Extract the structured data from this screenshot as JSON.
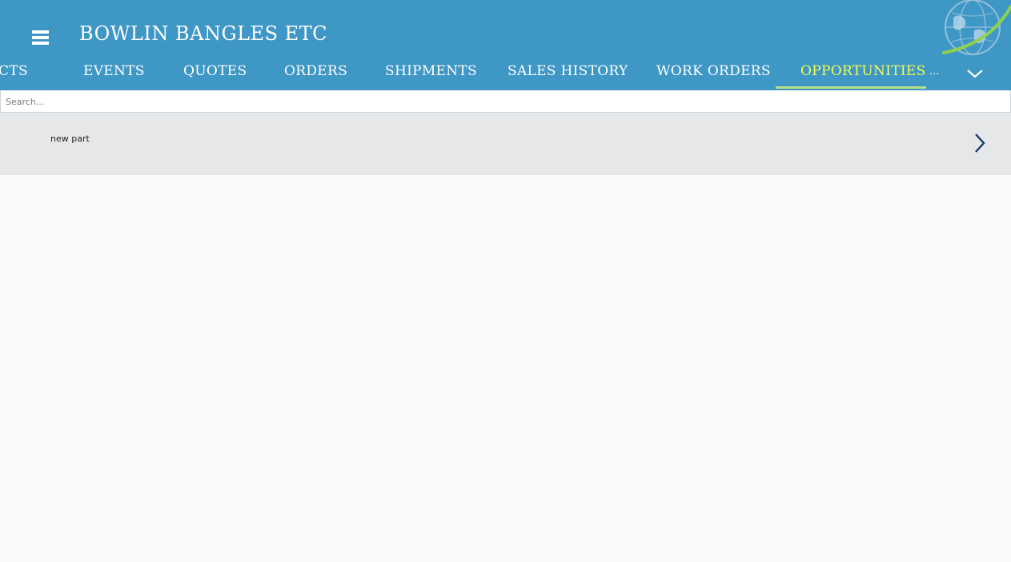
{
  "app": {
    "title": "BOWLIN BANGLES ETC"
  },
  "nav": {
    "tabs": [
      {
        "label": "CTS"
      },
      {
        "label": "EVENTS"
      },
      {
        "label": "QUOTES"
      },
      {
        "label": "ORDERS"
      },
      {
        "label": "SHIPMENTS"
      },
      {
        "label": "SALES HISTORY"
      },
      {
        "label": "WORK ORDERS"
      },
      {
        "label": "OPPORTUNITIES",
        "active": true
      }
    ],
    "more_label": "..."
  },
  "search": {
    "placeholder": "Search...",
    "value": ""
  },
  "list": {
    "items": [
      {
        "label": "new part"
      }
    ]
  },
  "icons": {
    "menu": "hamburger-menu-icon",
    "logo": "globe-logo-icon",
    "expand": "chevron-down-icon",
    "row_open": "chevron-right-icon"
  },
  "colors": {
    "header_bg": "#3f97c6",
    "active_tab": "#f3fb53",
    "row_bg": "#e6e7e8",
    "page_bg": "#f9f9f9"
  }
}
